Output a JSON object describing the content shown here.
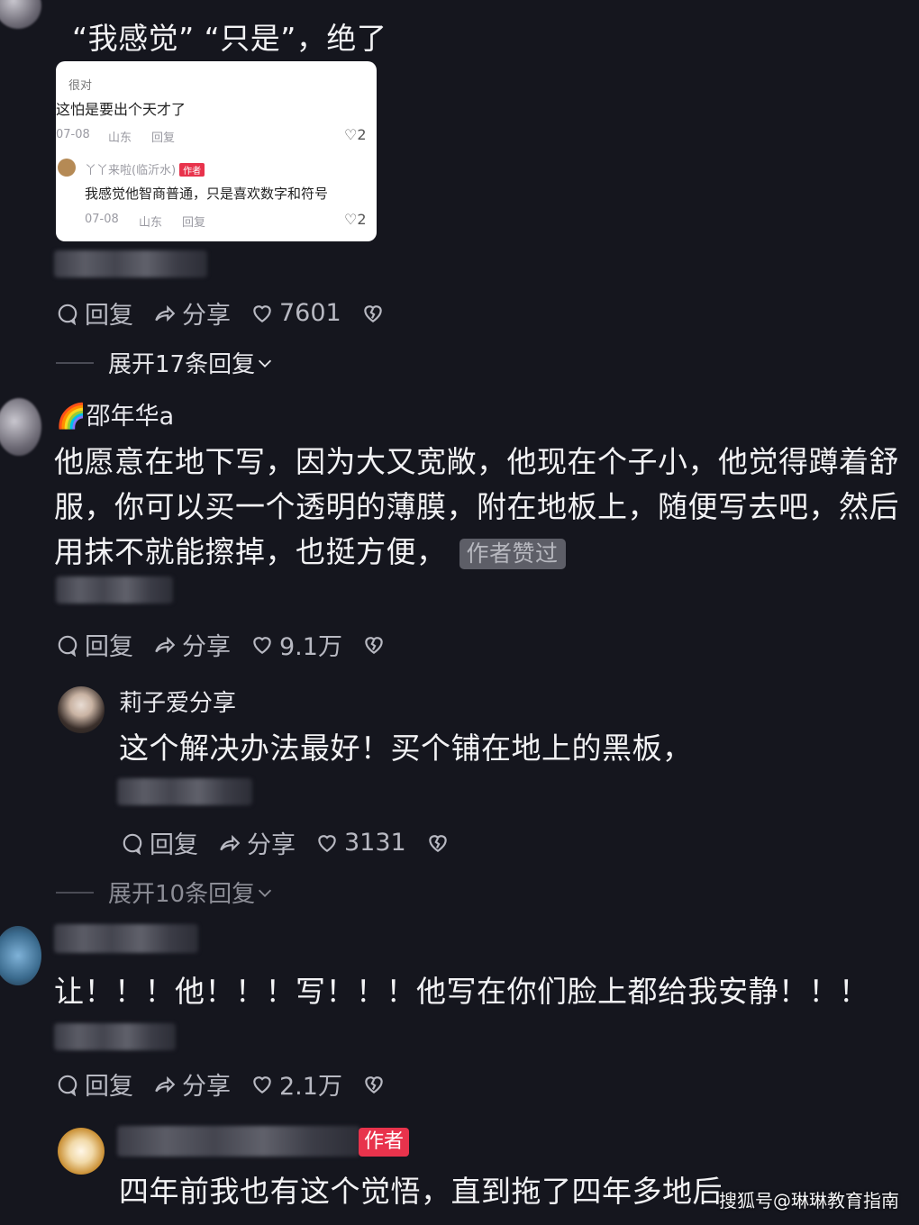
{
  "top_comment": {
    "text": "“我感觉” “只是”，绝了",
    "card": {
      "user1": "很对",
      "comment1": "这怕是要出个天才了",
      "meta1_date": "07-08",
      "meta1_loc": "山东",
      "meta1_reply": "回复",
      "like1": "2",
      "user2": "丫丫来啦(临沂水)",
      "user2_badge": "作者",
      "comment2": "我感觉他智商普通，只是喜欢数字和符号",
      "meta2_date": "07-08",
      "meta2_loc": "山东",
      "meta2_reply": "回复",
      "like2": "2"
    },
    "actions": {
      "reply": "回复",
      "share": "分享",
      "likes": "7601"
    },
    "expand": "展开17条回复"
  },
  "comment2": {
    "username": "🌈邵年华a",
    "text": "他愿意在地下写，因为大又宽敞，他现在个子小，他觉得蹲着舒服，你可以买一个透明的薄膜，附在地板上，随便写去吧，然后用抹不就能擦掉，也挺方便，",
    "tag": "作者赞过",
    "actions": {
      "reply": "回复",
      "share": "分享",
      "likes": "9.1万"
    }
  },
  "reply1": {
    "username": "莉子爱分享",
    "text": "这个解决办法最好！买个铺在地上的黑板，",
    "actions": {
      "reply": "回复",
      "share": "分享",
      "likes": "3131"
    },
    "expand": "展开10条回复"
  },
  "comment3": {
    "text": "让！！！他！！！写！！！他写在你们脸上都给我安静！！！",
    "actions": {
      "reply": "回复",
      "share": "分享",
      "likes": "2.1万"
    }
  },
  "reply2": {
    "badge": "作者",
    "text": "四年前我也有这个觉悟，直到拖了四年多地后"
  },
  "watermark": "搜狐号@琳琳教育指南",
  "colors": {
    "background": "#15161e",
    "tag_bg": "#5d5e67",
    "badge": "#e8334c"
  }
}
